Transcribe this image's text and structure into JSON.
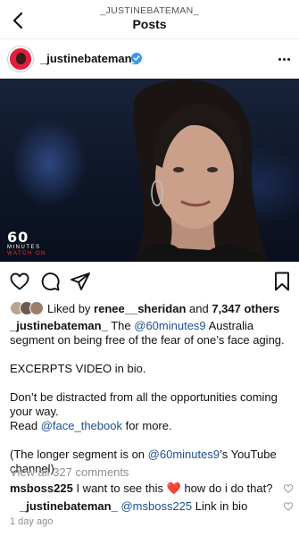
{
  "topbar": {
    "username": "_JUSTINEBATEMAN_",
    "title": "Posts"
  },
  "post": {
    "username": "_justinebateman_",
    "verified": true,
    "media": {
      "logo_number": "60",
      "logo_text": "MINUTES",
      "logo_sub": "WATCH ON"
    },
    "likes": {
      "prefix": "Liked by",
      "user": "renee__sheridan",
      "joiner": "and",
      "others": "7,347 others"
    },
    "caption": {
      "author": "_justinebateman_",
      "line1_a": "The",
      "line1_mention": "@60minutes9",
      "line1_b": "Australia segment on being free of the fear of one’s face aging.",
      "para2": "EXCERPTS VIDEO in bio.",
      "para3_a": "Don’t be distracted from all the opportunities coming your way.",
      "para3_b": "Read",
      "para3_mention": "@face_thebook",
      "para3_c": "for more.",
      "para4_a": "(The longer segment is on",
      "para4_mention": "@60minutes9",
      "para4_b": "’s YouTube channel)"
    },
    "view_all": "View all 327 comments",
    "comments": [
      {
        "user": "msboss225",
        "text_a": "I want to see this",
        "emoji": "❤️",
        "text_b": "how do i do that?"
      },
      {
        "user": "_justinebateman_",
        "mention": "@msboss225",
        "text": "Link in bio"
      }
    ],
    "time_ago": "1 day ago"
  },
  "colors": {
    "mention": "#1e4f93",
    "verified": "#3897f0",
    "avatar_ring": "#e01f3d",
    "muted": "#8e8e8e"
  },
  "icons": [
    "back-arrow-icon",
    "verified-badge-icon",
    "more-options-icon",
    "heart-icon",
    "comment-icon",
    "share-icon",
    "bookmark-icon"
  ]
}
